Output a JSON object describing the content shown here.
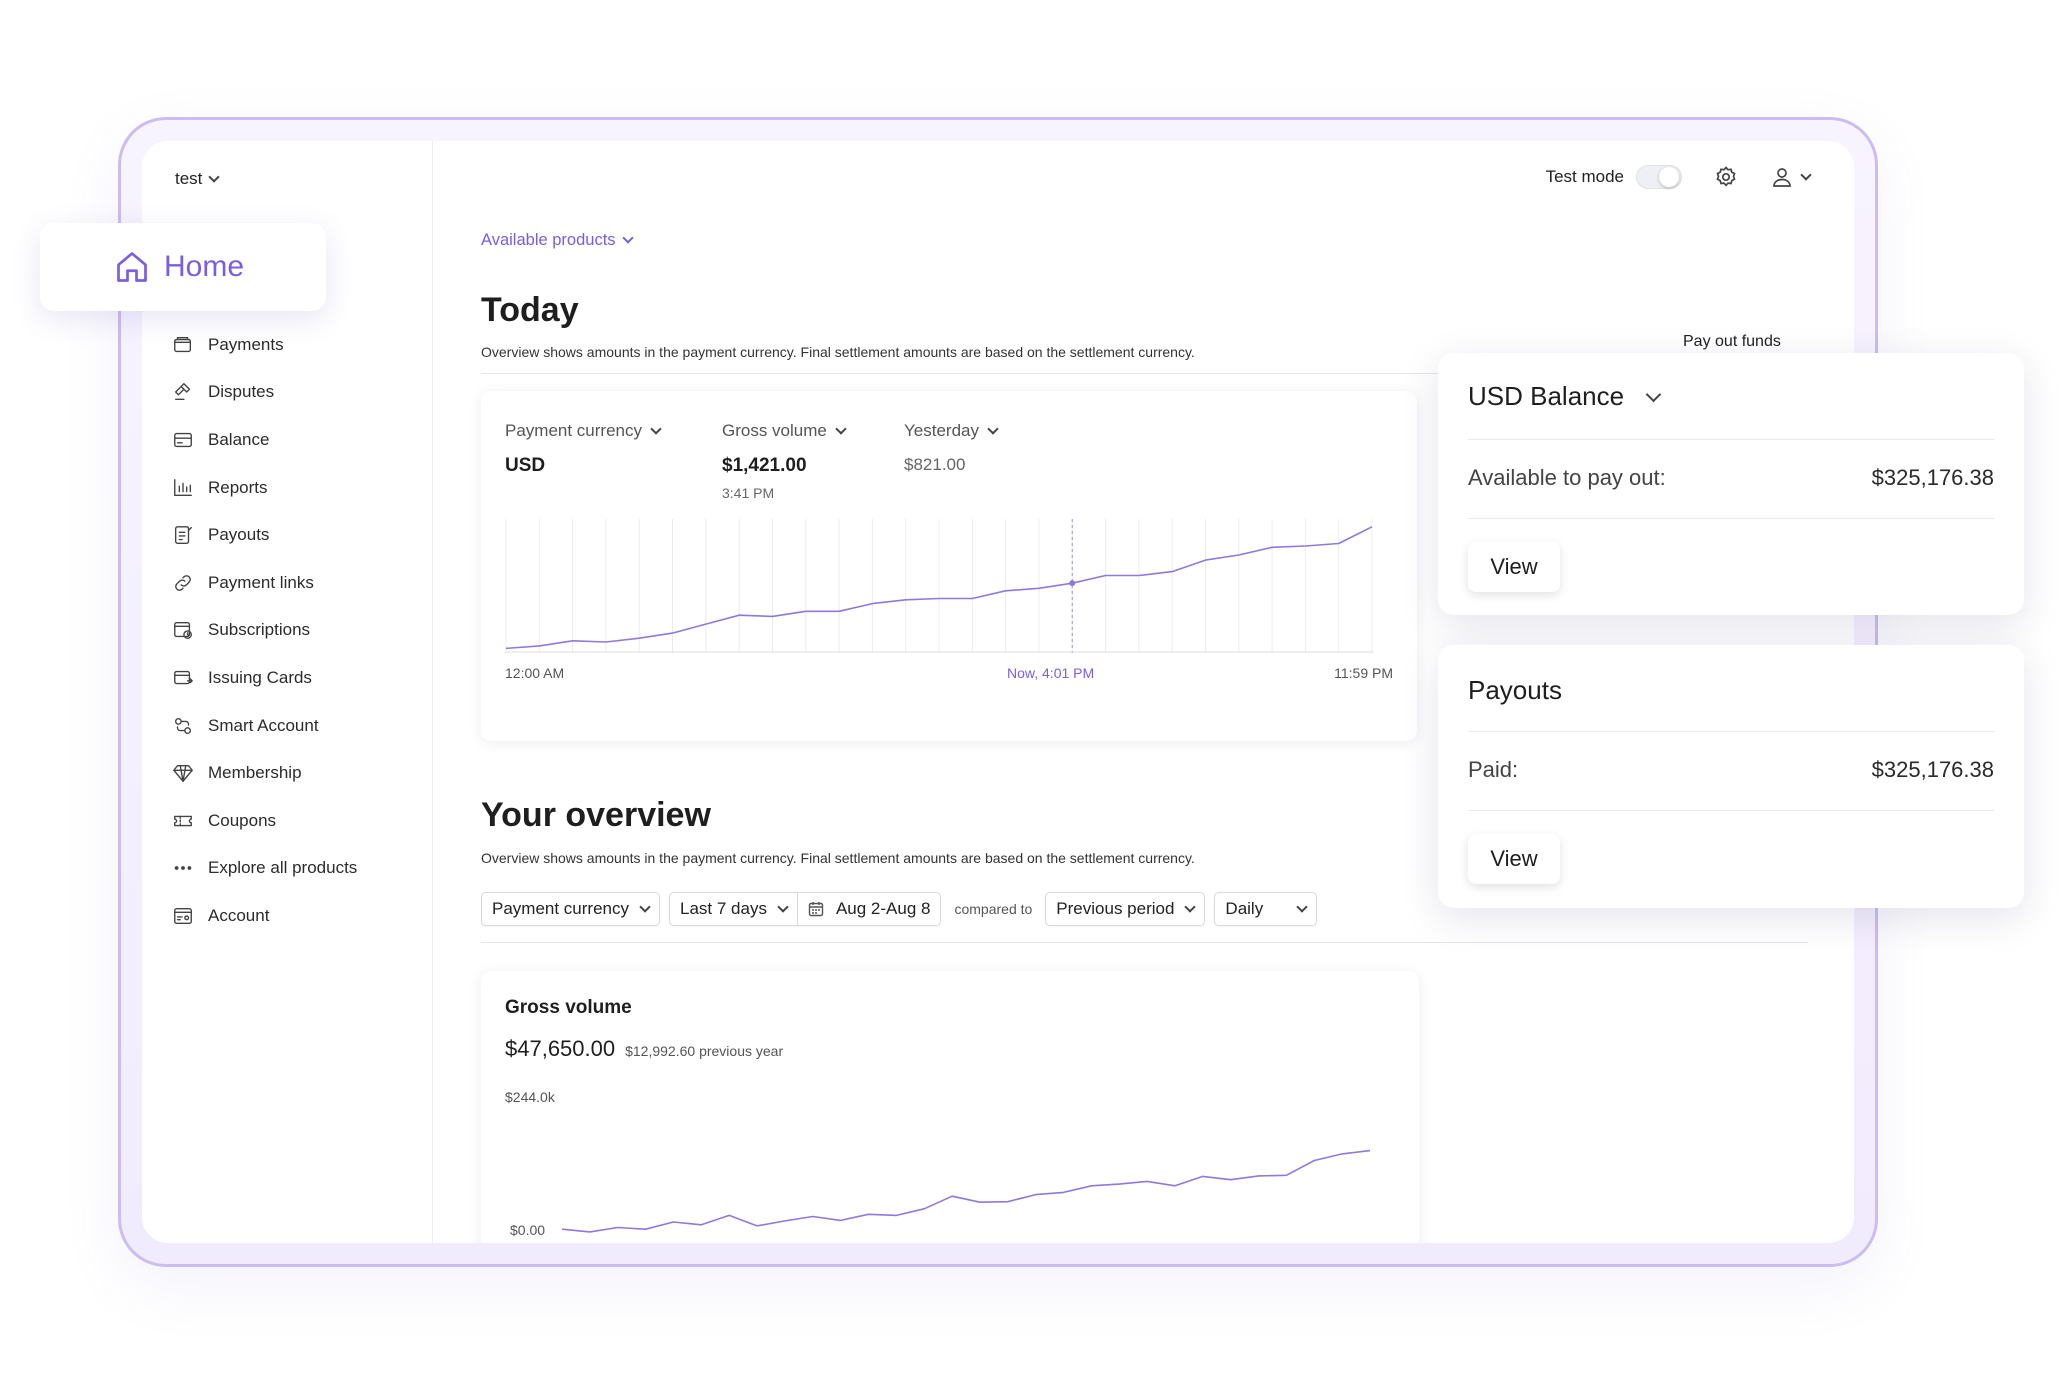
{
  "sidebar": {
    "account_name": "test",
    "home_label": "Home",
    "items": [
      {
        "label": "Payments",
        "icon": "wallet-icon"
      },
      {
        "label": "Disputes",
        "icon": "gavel-icon"
      },
      {
        "label": "Balance",
        "icon": "card-icon"
      },
      {
        "label": "Reports",
        "icon": "bar-chart-icon"
      },
      {
        "label": "Payouts",
        "icon": "payout-doc-icon"
      },
      {
        "label": "Payment links",
        "icon": "link-icon"
      },
      {
        "label": "Subscriptions",
        "icon": "subscription-icon"
      },
      {
        "label": "Issuing Cards",
        "icon": "issuing-card-icon"
      },
      {
        "label": "Smart Account",
        "icon": "smart-account-icon"
      },
      {
        "label": "Membership",
        "icon": "diamond-icon"
      },
      {
        "label": "Coupons",
        "icon": "ticket-icon"
      },
      {
        "label": "Explore all products",
        "icon": "more-dots-icon"
      },
      {
        "label": "Account",
        "icon": "account-card-icon"
      }
    ]
  },
  "topbar": {
    "test_mode_label": "Test mode"
  },
  "available_products_label": "Available products",
  "today": {
    "title": "Today",
    "note": "Overview shows amounts in the payment currency. Final settlement amounts are based on the settlement currency.",
    "payment_currency_label": "Payment currency",
    "payment_currency_value": "USD",
    "gross_volume_label": "Gross volume",
    "gross_volume_value": "$1,421.00",
    "gross_volume_time": "3:41 PM",
    "yesterday_label": "Yesterday",
    "yesterday_value": "$821.00",
    "axis_start": "12:00 AM",
    "axis_now": "Now, 4:01 PM",
    "axis_end": "11:59 PM"
  },
  "overview": {
    "title": "Your overview",
    "note": "Overview shows amounts in the payment currency. Final settlement amounts are based on the settlement currency.",
    "filter_currency": "Payment currency",
    "filter_range": "Last 7 days",
    "filter_dates": "Aug 2-Aug 8",
    "compared_to": "compared to",
    "filter_compare": "Previous period",
    "filter_interval": "Daily",
    "gross_title": "Gross volume",
    "gross_value": "$47,650.00",
    "gross_previous": "$12,992.60 previous year",
    "y_top": "$244.0k",
    "y_bottom": "$0.00"
  },
  "balance_card": {
    "title": "USD Balance",
    "available_label": "Available to pay out:",
    "available_value": "$325,176.38",
    "view_label": "View",
    "pay_out_funds": "Pay out funds"
  },
  "payouts_card": {
    "title": "Payouts",
    "paid_label": "Paid:",
    "paid_value": "$325,176.38",
    "view_label": "View"
  },
  "colors": {
    "accent": "#7b5ce6",
    "frame": "#cbbcf2",
    "line": "#8f78e0"
  },
  "chart_data": [
    {
      "type": "line",
      "title": "",
      "x": [
        0,
        1,
        2,
        3,
        4,
        5,
        6,
        7,
        8,
        9,
        10,
        11,
        12,
        13,
        14,
        15,
        16,
        17,
        18,
        19,
        20,
        21,
        22,
        23,
        24,
        25,
        26
      ],
      "values": [
        2,
        4,
        8,
        7,
        10,
        14,
        21,
        28,
        27,
        31,
        31,
        37,
        40,
        41,
        41,
        47,
        49,
        53,
        59,
        59,
        62,
        71,
        75,
        81,
        82,
        84,
        97
      ],
      "ylim": [
        0,
        100
      ],
      "xlabel": "",
      "ylabel": ""
    },
    {
      "type": "line",
      "title": "Gross volume",
      "x": [
        0,
        1,
        2,
        3,
        4,
        5,
        6,
        7,
        8,
        9,
        10,
        11,
        12,
        13,
        14,
        15,
        16,
        17,
        18,
        19,
        20,
        21,
        22,
        23,
        24,
        25,
        26,
        27,
        28,
        29
      ],
      "values": [
        7,
        2,
        10,
        7,
        20,
        15,
        32,
        13,
        22,
        30,
        23,
        34,
        32,
        44,
        67,
        56,
        57,
        70,
        74,
        86,
        89,
        94,
        86,
        103,
        97,
        104,
        105,
        132,
        144,
        150
      ],
      "ylim": [
        0,
        244
      ],
      "xlabel": "",
      "ylabel": ""
    }
  ]
}
